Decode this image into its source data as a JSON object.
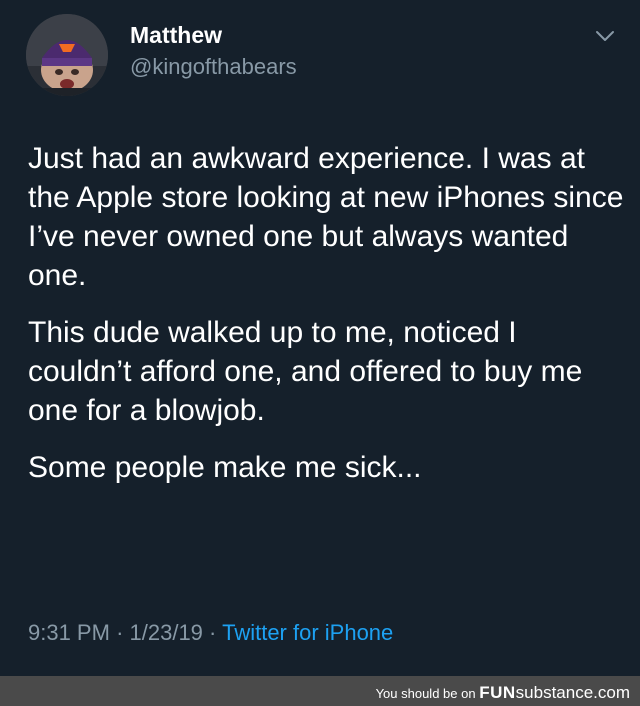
{
  "tweet": {
    "author": {
      "name": "Matthew",
      "handle": "@kingofthabears",
      "avatar_icon": "avatar-crying-fan"
    },
    "menu_icon": "chevron-down-icon",
    "paragraphs": [
      "Just had an awkward experience. I was at the Apple store looking at new iPhones since I’ve never owned one but always wanted one.",
      "This dude walked up to me, noticed I couldn’t afford one, and offered to buy me one for a blowjob.",
      "Some people make me sick..."
    ],
    "time": "9:31 PM",
    "separator": "·",
    "date": "1/23/19",
    "source": "Twitter for iPhone"
  },
  "footer": {
    "prefix": "You should be on",
    "brand_bold": "FUN",
    "brand_rest": "substance",
    "suffix": ".com"
  },
  "colors": {
    "background": "#15202b",
    "text": "#ffffff",
    "secondary": "#8899a6",
    "link": "#1da1f2",
    "footer_bg": "#4a4a4a"
  }
}
